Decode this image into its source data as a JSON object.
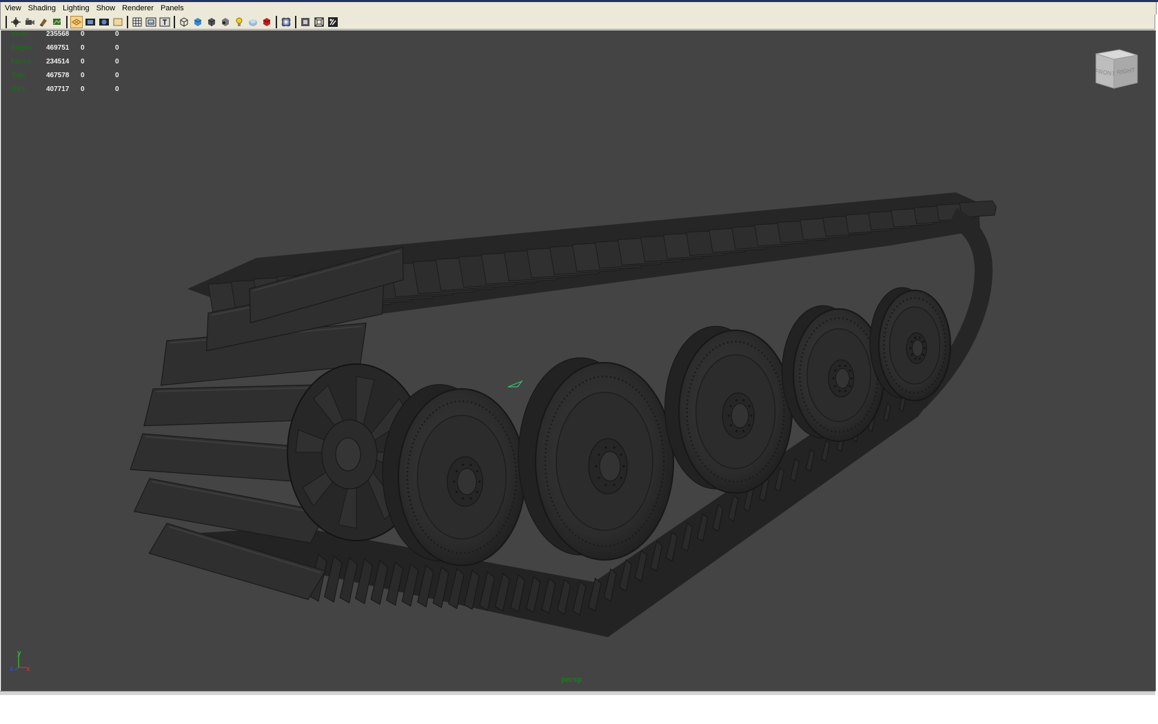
{
  "menubar": {
    "items": [
      "View",
      "Shading",
      "Lighting",
      "Show",
      "Renderer",
      "Panels"
    ]
  },
  "toolbar": {
    "groups": [
      [
        "select-camera-icon",
        "camera-attributes-icon",
        "bookmark-icon",
        "image-plane-icon"
      ],
      [
        "grid-icon",
        "film-gate-icon",
        "resolution-gate-icon",
        "gate-mask-icon"
      ],
      [
        "field-chart-icon",
        "safe-action-icon",
        "safe-title-icon"
      ],
      [
        "wireframe-icon",
        "smooth-shade-icon",
        "flat-shade-icon",
        "bounding-box-icon",
        "use-lights-icon",
        "textured-icon",
        "shadows-icon"
      ],
      [
        "isolate-select-icon"
      ],
      [
        "xray-icon",
        "xray-joints-icon",
        "wireframe-on-shaded-icon"
      ]
    ],
    "active": [
      "grid-icon"
    ]
  },
  "hud": {
    "rows": [
      {
        "label": "Verts:",
        "v1": "235568",
        "v2": "0",
        "v3": "0"
      },
      {
        "label": "Edges:",
        "v1": "469751",
        "v2": "0",
        "v3": "0"
      },
      {
        "label": "Faces:",
        "v1": "234514",
        "v2": "0",
        "v3": "0"
      },
      {
        "label": "Tris:",
        "v1": "467578",
        "v2": "0",
        "v3": "0"
      },
      {
        "label": "UVs:",
        "v1": "407717",
        "v2": "0",
        "v3": "0"
      }
    ]
  },
  "viewcube": {
    "front": "FRONT",
    "right": "RIGHT"
  },
  "axis": {
    "y": "y",
    "z": "z",
    "x": "x"
  },
  "viewport": {
    "camera": "persp"
  },
  "colors": {
    "viewport_bg": "#444444",
    "hud_label": "#1f6a1f",
    "model": "#2e2e2e"
  }
}
